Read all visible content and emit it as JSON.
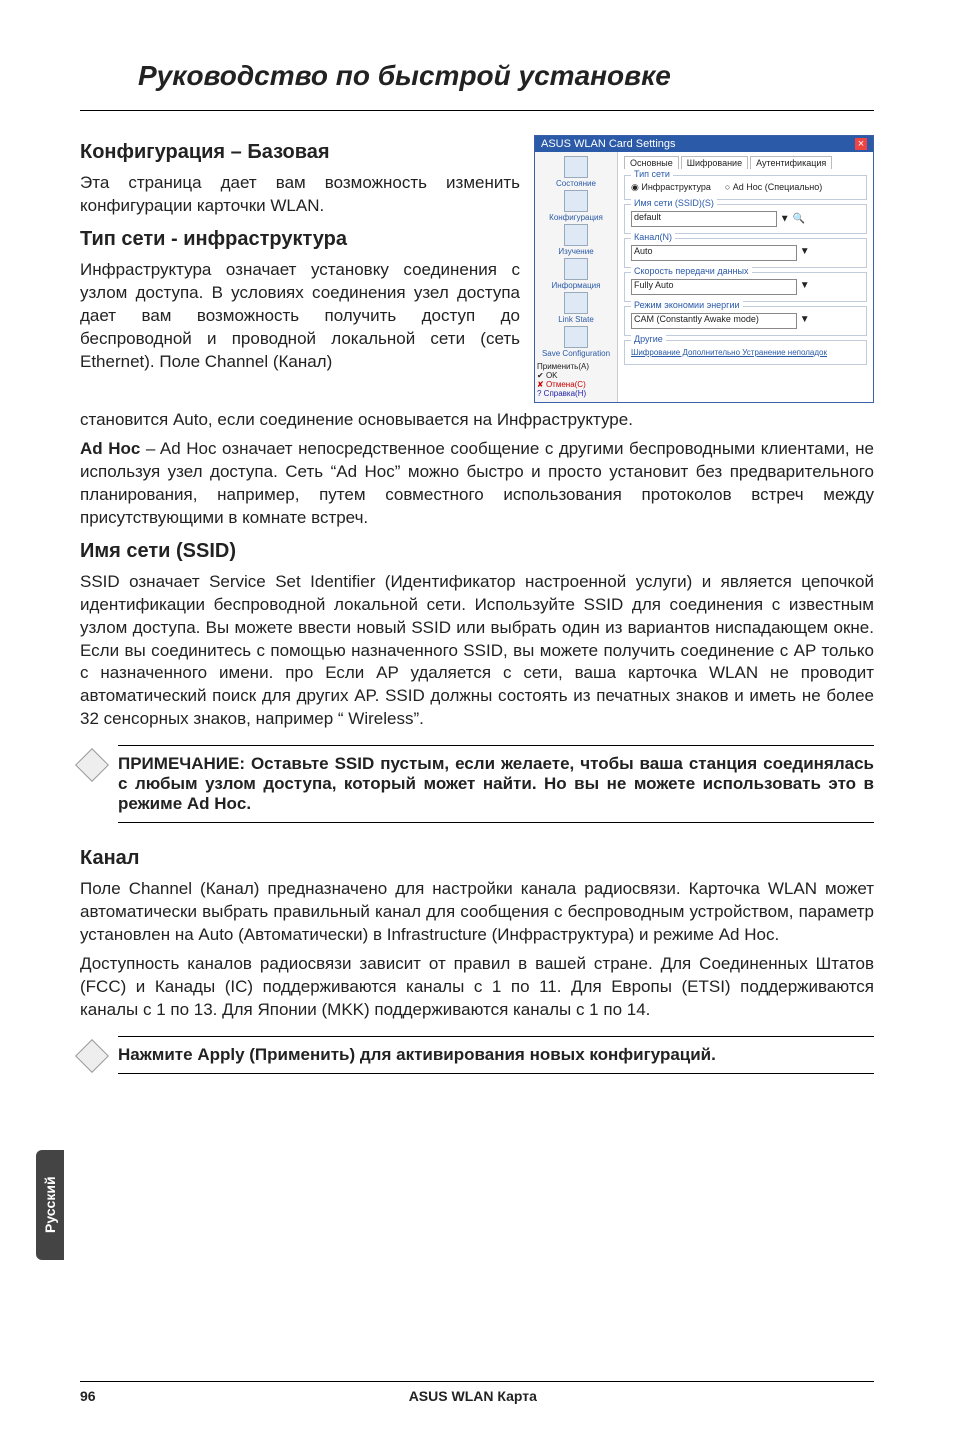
{
  "title": "Руководство по быстрой установке",
  "sections": {
    "config": {
      "heading": "Конфигурация – Базовая",
      "para": "Эта страница дает вам возможность изменить конфигурации карточки WLAN."
    },
    "nettype": {
      "heading": "Тип сети - инфраструктура",
      "para1": "Инфраструктура означает установку соединения с узлом доступа. В условиях соединения узел доступа дает вам возможность получить доступ до беспроводной и проводной локальной сети (сеть Ethernet). Поле Channel (Канал)",
      "para_continue": "становится Auto, если соединение основывается на Инфраструктуре."
    },
    "adhoc": {
      "lead": "Ad Hoc",
      "text": " – Ad Hoc означает непосредственное сообщение с другими беспроводными клиентами, не используя узел доступа. Сеть “Ad Hoc” можно быстро и просто установит без предварительного планирования, например, путем совместного использования протоколов встреч между присутствующими в комнате встреч."
    },
    "ssid": {
      "heading": "Имя сети (SSID)",
      "para": "SSID означает Service Set Identifier (Идентификатор настроенной услуги) и является цепочкой идентификации беспроводной локальной сети. Используйте SSID для соединения с известным узлом доступа. Вы можете ввести новый SSID или выбрать один из вариантов ниспадающем окне.  Если вы соединитесь с помощью назначенного SSID, вы можете получить соединение с AP только с назначенного имени. про Если AP удаляется с сети, ваша карточка WLAN не проводит автоматический поиск для других AP. SSID должны состоять из печатных знаков и иметь не более 32 сенсорных знаков, например “ Wireless”."
    },
    "note1": "ПРИМЕЧАНИЕ: Оставьте SSID пустым, если желаете, чтобы ваша станция соединялась с любым узлом доступа, который может найти. Но вы не можете использовать это в режиме Ad Hoc.",
    "channel": {
      "heading": "Канал",
      "para1": "Поле Channel (Канал) предназначено для настройки канала радиосвязи. Карточка WLAN может автоматически выбрать правильный канал для сообщения с беспроводным устройством, параметр установлен на Auto (Автоматически) в Infrastructure (Инфраструктура) и режиме Ad Hoc.",
      "para2": "Доступность каналов радиосвязи зависит от правил в вашей стране. Для Соединенных Штатов (FCC) и Канады (IC) поддерживаются каналы с 1 по 11. Для Европы (ETSI) поддерживаются каналы с 1 по 13. Для Японии (MKK) поддерживаются каналы  с 1 по 14."
    },
    "note2": "Нажмите Apply (Применить) для активирования новых конфигураций."
  },
  "screenshot": {
    "title": "ASUS WLAN Card Settings",
    "tabs": [
      "Основные",
      "Шифрование",
      "Аутентификация"
    ],
    "nav": [
      "Состояние",
      "Конфигурация",
      "Изучение",
      "Информация",
      "Link State",
      "Save Configuration"
    ],
    "groups": {
      "net": "Тип сети",
      "ssid": "Имя сети (SSID)(S)",
      "chan": "Канал(N)",
      "rate": "Скорость передачи данных",
      "pwr": "Режим экономии энергии",
      "other": "Другие"
    },
    "radio1": "Инфраструктура",
    "radio2": "Ad Hoc (Специально)",
    "ssid_val": "default",
    "chan_val": "Auto",
    "rate_val": "Fully Auto",
    "pwr_val": "CAM (Constantly Awake mode)",
    "links": "Шифрование   Дополнительно   Устранение неполадок",
    "btns": {
      "apply": "Применить(A)",
      "ok": "OK",
      "cancel": "Отмена(C)",
      "help": "Справка(H)"
    }
  },
  "sidetab": "Русский",
  "footer": {
    "page": "96",
    "product": "ASUS WLAN Карта"
  }
}
